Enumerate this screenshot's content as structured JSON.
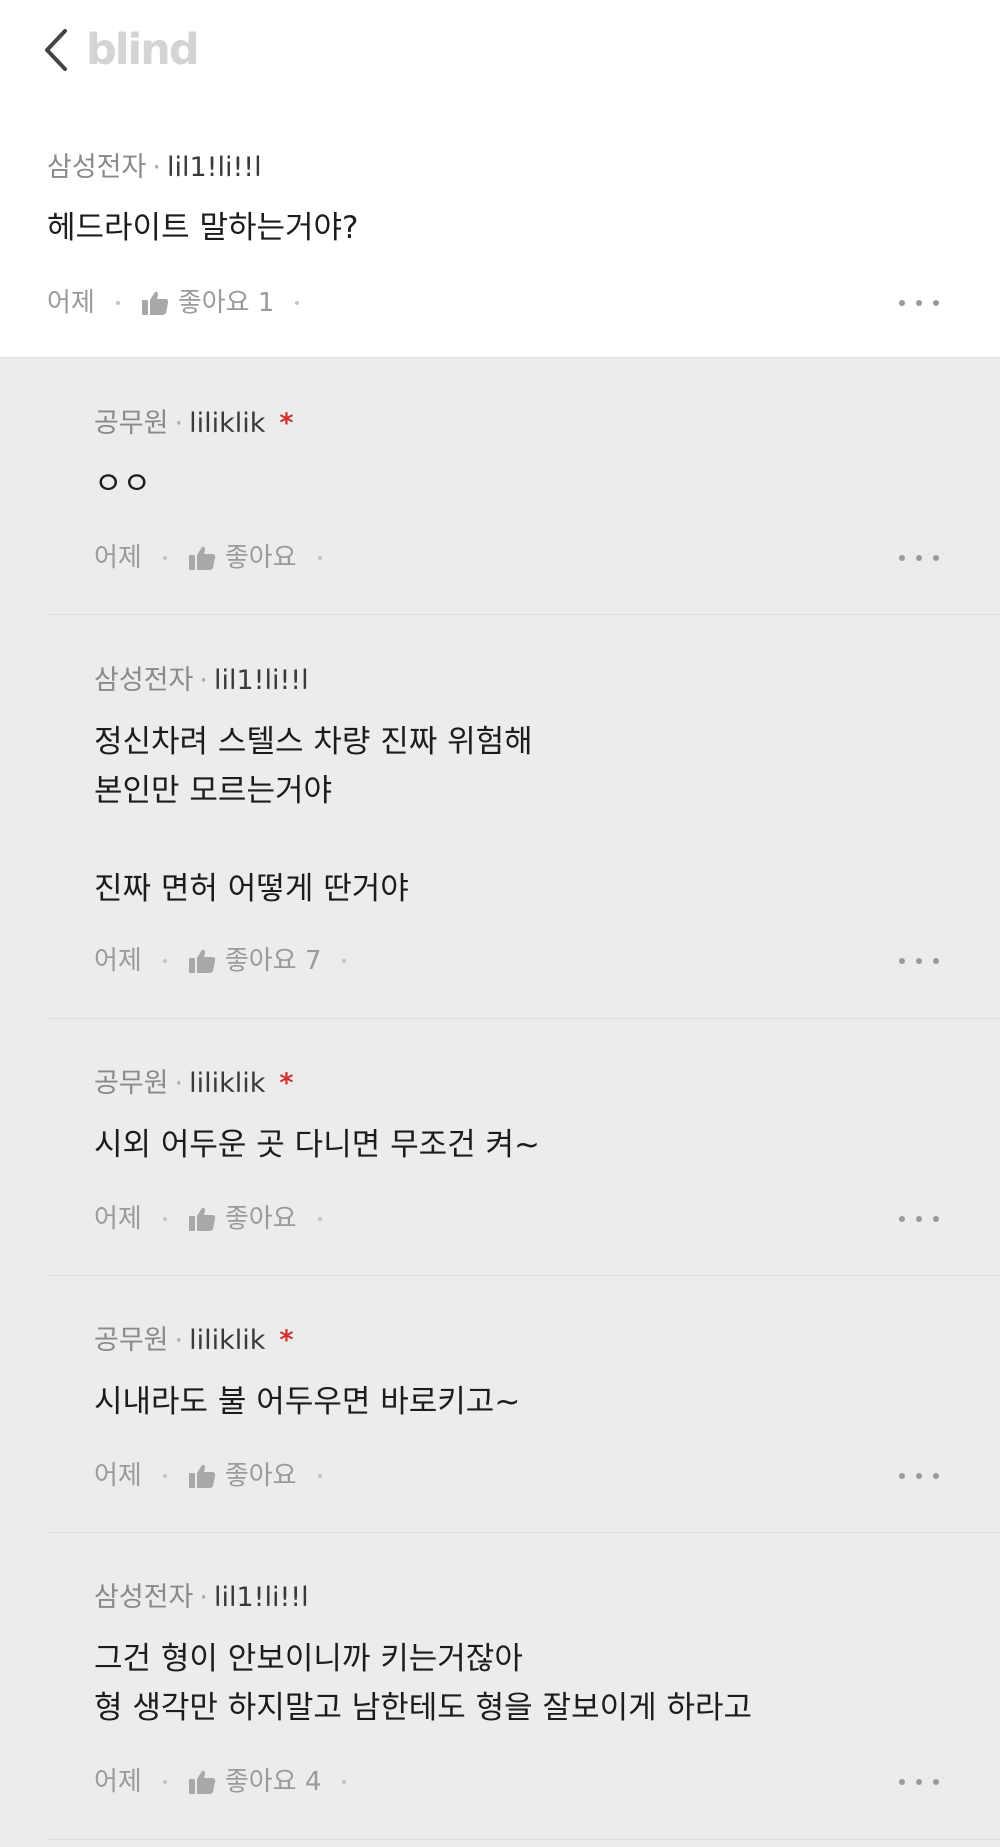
{
  "header": {
    "logo": "blind"
  },
  "post": {
    "company": "삼성전자",
    "nickname": "lil1!li!!l",
    "text": "헤드라이트 말하는거야?",
    "time": "어제",
    "like_label": "좋아요 1"
  },
  "replies": [
    {
      "company": "공무원",
      "nickname": "liliklik",
      "author_mark": "*",
      "text": "ㅇㅇ",
      "time": "어제",
      "like_label": "좋아요"
    },
    {
      "company": "삼성전자",
      "nickname": "lil1!li!!l",
      "author_mark": "",
      "text": "정신차려 스텔스 차량 진짜 위험해\n본인만 모르는거야\n\n진짜 면허 어떻게 딴거야",
      "time": "어제",
      "like_label": "좋아요 7"
    },
    {
      "company": "공무원",
      "nickname": "liliklik",
      "author_mark": "*",
      "text": "시외 어두운 곳 다니면 무조건 켜~",
      "time": "어제",
      "like_label": "좋아요"
    },
    {
      "company": "공무원",
      "nickname": "liliklik",
      "author_mark": "*",
      "text": "시내라도 불 어두우면 바로키고~",
      "time": "어제",
      "like_label": "좋아요"
    },
    {
      "company": "삼성전자",
      "nickname": "lil1!li!!l",
      "author_mark": "",
      "text": "그건 형이 안보이니까 키는거잖아\n형 생각만 하지말고 남한테도 형을 잘보이게 하라고",
      "time": "어제",
      "like_label": "좋아요 4"
    }
  ],
  "colors": {
    "author_mark": "#d0312d",
    "logo": "#d4d4d4",
    "reply_bg": "#ececed"
  },
  "icons": {
    "back": "chevron-left-icon",
    "like": "thumbs-up-icon",
    "more": "more-horizontal-icon"
  }
}
